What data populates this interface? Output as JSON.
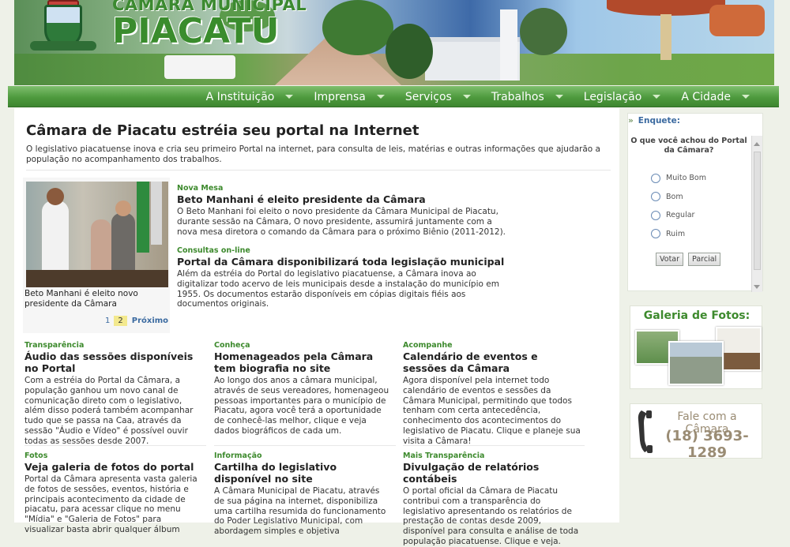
{
  "header": {
    "brand_small": "CÂMARA MUNICIPAL",
    "brand_big": "PIACATU"
  },
  "nav": {
    "items": [
      "A Instituição",
      "Imprensa",
      "Serviços",
      "Trabalhos",
      "Legislação",
      "A Cidade"
    ]
  },
  "main": {
    "headline": "Câmara de Piacatu estréia seu portal na Internet",
    "intro": "O legislativo piacatuense inova e cria seu primeiro Portal na internet, para consulta de leis, matérias e outras informações que ajudarão a população no acompanhamento dos trabalhos.",
    "feature": {
      "caption": "Beto Manhani é eleito novo presidente da Câmara",
      "pager": {
        "pages": [
          "1",
          "2"
        ],
        "next": "Próximo"
      }
    },
    "top_news": [
      {
        "tag": "Nova Mesa",
        "title": "Beto Manhani é eleito presidente da Câmara",
        "text": "O Beto Manhani foi eleito o novo presidente da Câmara Municipal de Piacatu, durante sessão na Câmara, O novo presidente, assumirá juntamente com a nova mesa diretora o comando da Câmara para o próximo Biênio (2011-2012)."
      },
      {
        "tag": "Consultas on-line",
        "title": "Portal da Câmara disponibilizará toda legislação municipal",
        "text": "Além da estréia do Portal do legislativo piacatuense, a Câmara inova ao digitalizar todo acervo de leis municipais desde a instalação do município em 1955. Os documentos estarão disponíveis em cópias digitais fiéis aos documentos originais."
      }
    ],
    "grid_news": [
      {
        "tag": "Transparência",
        "title": "Áudio das sessões disponíveis no Portal",
        "text": "Com a estréia do Portal da Câmara, a população ganhou um novo canal de comunicação direto com o legislativo, além disso poderá também acompanhar tudo que se passa na Caa, através da sessão \"Áudio e Vídeo\" é possível ouvir todas as sessões desde 2007."
      },
      {
        "tag": "Conheça",
        "title": "Homenageados pela Câmara tem biografia no site",
        "text": "Ao longo dos anos a câmara municipal, através de seus vereadores, homenageou pessoas importantes para o município de Piacatu, agora você terá a oportunidade de conhecê-las melhor, clique e veja dados biográficos de cada um."
      },
      {
        "tag": "Acompanhe",
        "title": "Calendário de eventos e sessões da Câmara",
        "text": "Agora disponível pela internet todo calendário de eventos e sessões da Câmara Municipal, permitindo que todos tenham com certa antecedência, conhecimento dos acontecimentos do legislativo de Piacatu. Clique e planeje sua visita a Câmara!"
      },
      {
        "tag": "Fotos",
        "title": "Veja galeria de fotos do portal",
        "text": "Portal da Câmara apresenta vasta galeria de fotos de sessões, eventos, história e principais acontecimento da cidade de piacatu, para acessar clique no menu \"Mídia\" e \"Galeria de Fotos\" para visualizar basta abrir qualquer álbum"
      },
      {
        "tag": "Informação",
        "title": "Cartilha do legislativo disponível no site",
        "text": "A Câmara Municipal de Piacatu, através de sua página na internet, disponibiliza uma cartilha resumida do funcionamento do Poder Legislativo Municipal, com abordagem simples e objetiva"
      },
      {
        "tag": "Mais Transparência",
        "title": "Divulgação de relatórios contábeis",
        "text": "O portal oficial da Câmara de Piacatu contribui com a transparência do legislativo apresentando os relatórios de prestação de contas desde 2009, disponível para consulta e análise de toda população piacatuense. Clique e veja."
      }
    ]
  },
  "sidebar": {
    "poll": {
      "label": "Enquete:",
      "question": "O que você achou do Portal da Câmara?",
      "options": [
        "Muito Bom",
        "Bom",
        "Regular",
        "Ruim"
      ],
      "vote_label": "Votar",
      "partial_label": "Parcial"
    },
    "gallery_title": "Galeria de Fotos:",
    "contact": {
      "line1": "Fale com a Câmara",
      "phone": "(18) 3693-1289"
    }
  },
  "colors": {
    "brand_green": "#3a8c2d",
    "nav_green": "#4e9a3e",
    "link_blue": "#3b6aa0",
    "tag_green": "#3d8a2d"
  }
}
